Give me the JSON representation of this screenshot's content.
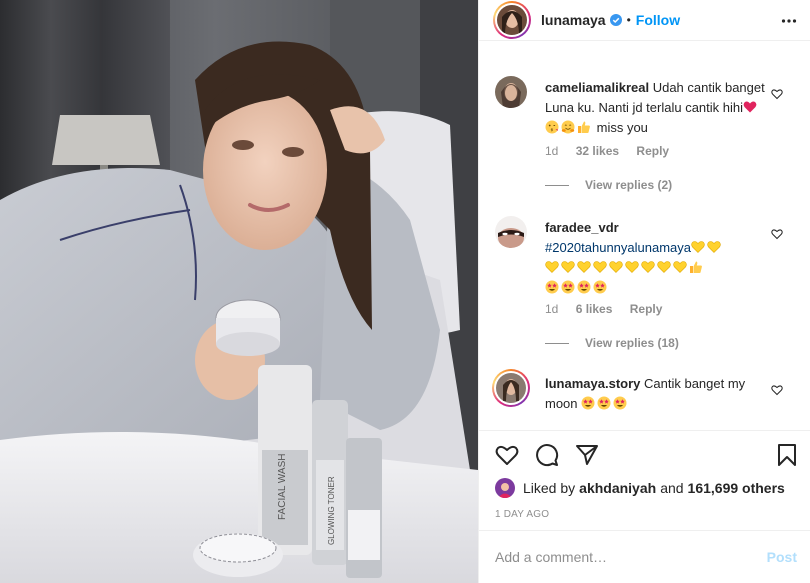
{
  "post": {
    "author": "lunamaya",
    "follow_label": "Follow",
    "separator": "•",
    "photo_labels": {
      "bottle1": "FACIAL WASH",
      "bottle2": "GLOWING TONER"
    }
  },
  "comments": [
    {
      "user": "cameliamalikreal",
      "text": "Udah cantik banget Luna ku. Nanti jd terlalu cantik hihi",
      "emojis": [
        "heart",
        "kiss",
        "hug",
        "thumbs"
      ],
      "text_after": "miss you",
      "age": "1d",
      "likes": "32 likes",
      "reply_label": "Reply",
      "view_replies": "View replies (2)"
    },
    {
      "user": "faradee_vdr",
      "hashtag": "#2020tahunnyalunamaya",
      "emojis_line1": [
        "yellow-heart",
        "yellow-heart"
      ],
      "emojis_line2": [
        "yellow-heart",
        "yellow-heart",
        "yellow-heart",
        "yellow-heart",
        "yellow-heart",
        "yellow-heart",
        "yellow-heart",
        "yellow-heart",
        "yellow-heart",
        "thumbs"
      ],
      "emojis_line3": [
        "star-eyes",
        "star-eyes",
        "star-eyes",
        "star-eyes"
      ],
      "age": "1d",
      "likes": "6 likes",
      "reply_label": "Reply",
      "view_replies": "View replies (18)"
    },
    {
      "user": "lunamaya.story",
      "text_a": "Cantik banget my",
      "text_b": "moon",
      "emojis": [
        "star-eyes",
        "star-eyes",
        "star-eyes"
      ]
    }
  ],
  "likes": {
    "prefix": "Liked by",
    "user": "akhdaniyah",
    "conj": "and",
    "count": "161,699 others"
  },
  "timestamp": "1 DAY AGO",
  "add_comment": {
    "placeholder": "Add a comment…",
    "post_label": "Post"
  },
  "colors": {
    "accent": "#0095f6",
    "muted": "#8e8e8e",
    "post_disabled": "#b2dffc",
    "hashtag": "#00376b"
  }
}
